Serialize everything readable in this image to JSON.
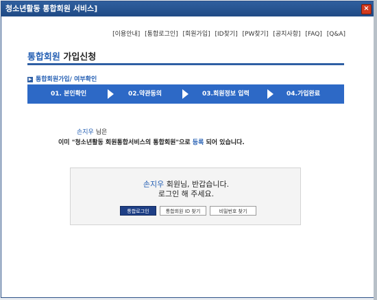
{
  "window": {
    "title": "청소년활동 통합회원 서비스]",
    "close_glyph": "×"
  },
  "topnav": [
    "[이용안내]",
    "[통합로그인]",
    "[회원가입]",
    "[ID찾기]",
    "[PW찾기]",
    "[공지사항]",
    "[FAQ]",
    "[Q&A]"
  ],
  "heading": {
    "accent": "통합회원",
    "rest": " 가입신청"
  },
  "section": {
    "bullet": "▶",
    "label": "통합회원가입/ 여부확인"
  },
  "steps": [
    "01. 본인확인",
    "02.약관동의",
    "03.회원정보 입력",
    "04.가입완료"
  ],
  "notice": {
    "name": "손지우",
    "suffix": " 님은",
    "line2_pre": "이미 \"청소년활동 회원통합서비스의 통합회원\"으로 ",
    "line2_reg": "등록",
    "line2_post": " 되어 있습니다."
  },
  "greeting": {
    "name": "손지우",
    "line1_rest": " 회원님, 반갑습니다.",
    "line2": "로그인 해 주세요."
  },
  "buttons": {
    "login": "통합로그인",
    "find_id": "통합회원 ID 찾기",
    "find_pw": "비밀번호 찾기"
  }
}
